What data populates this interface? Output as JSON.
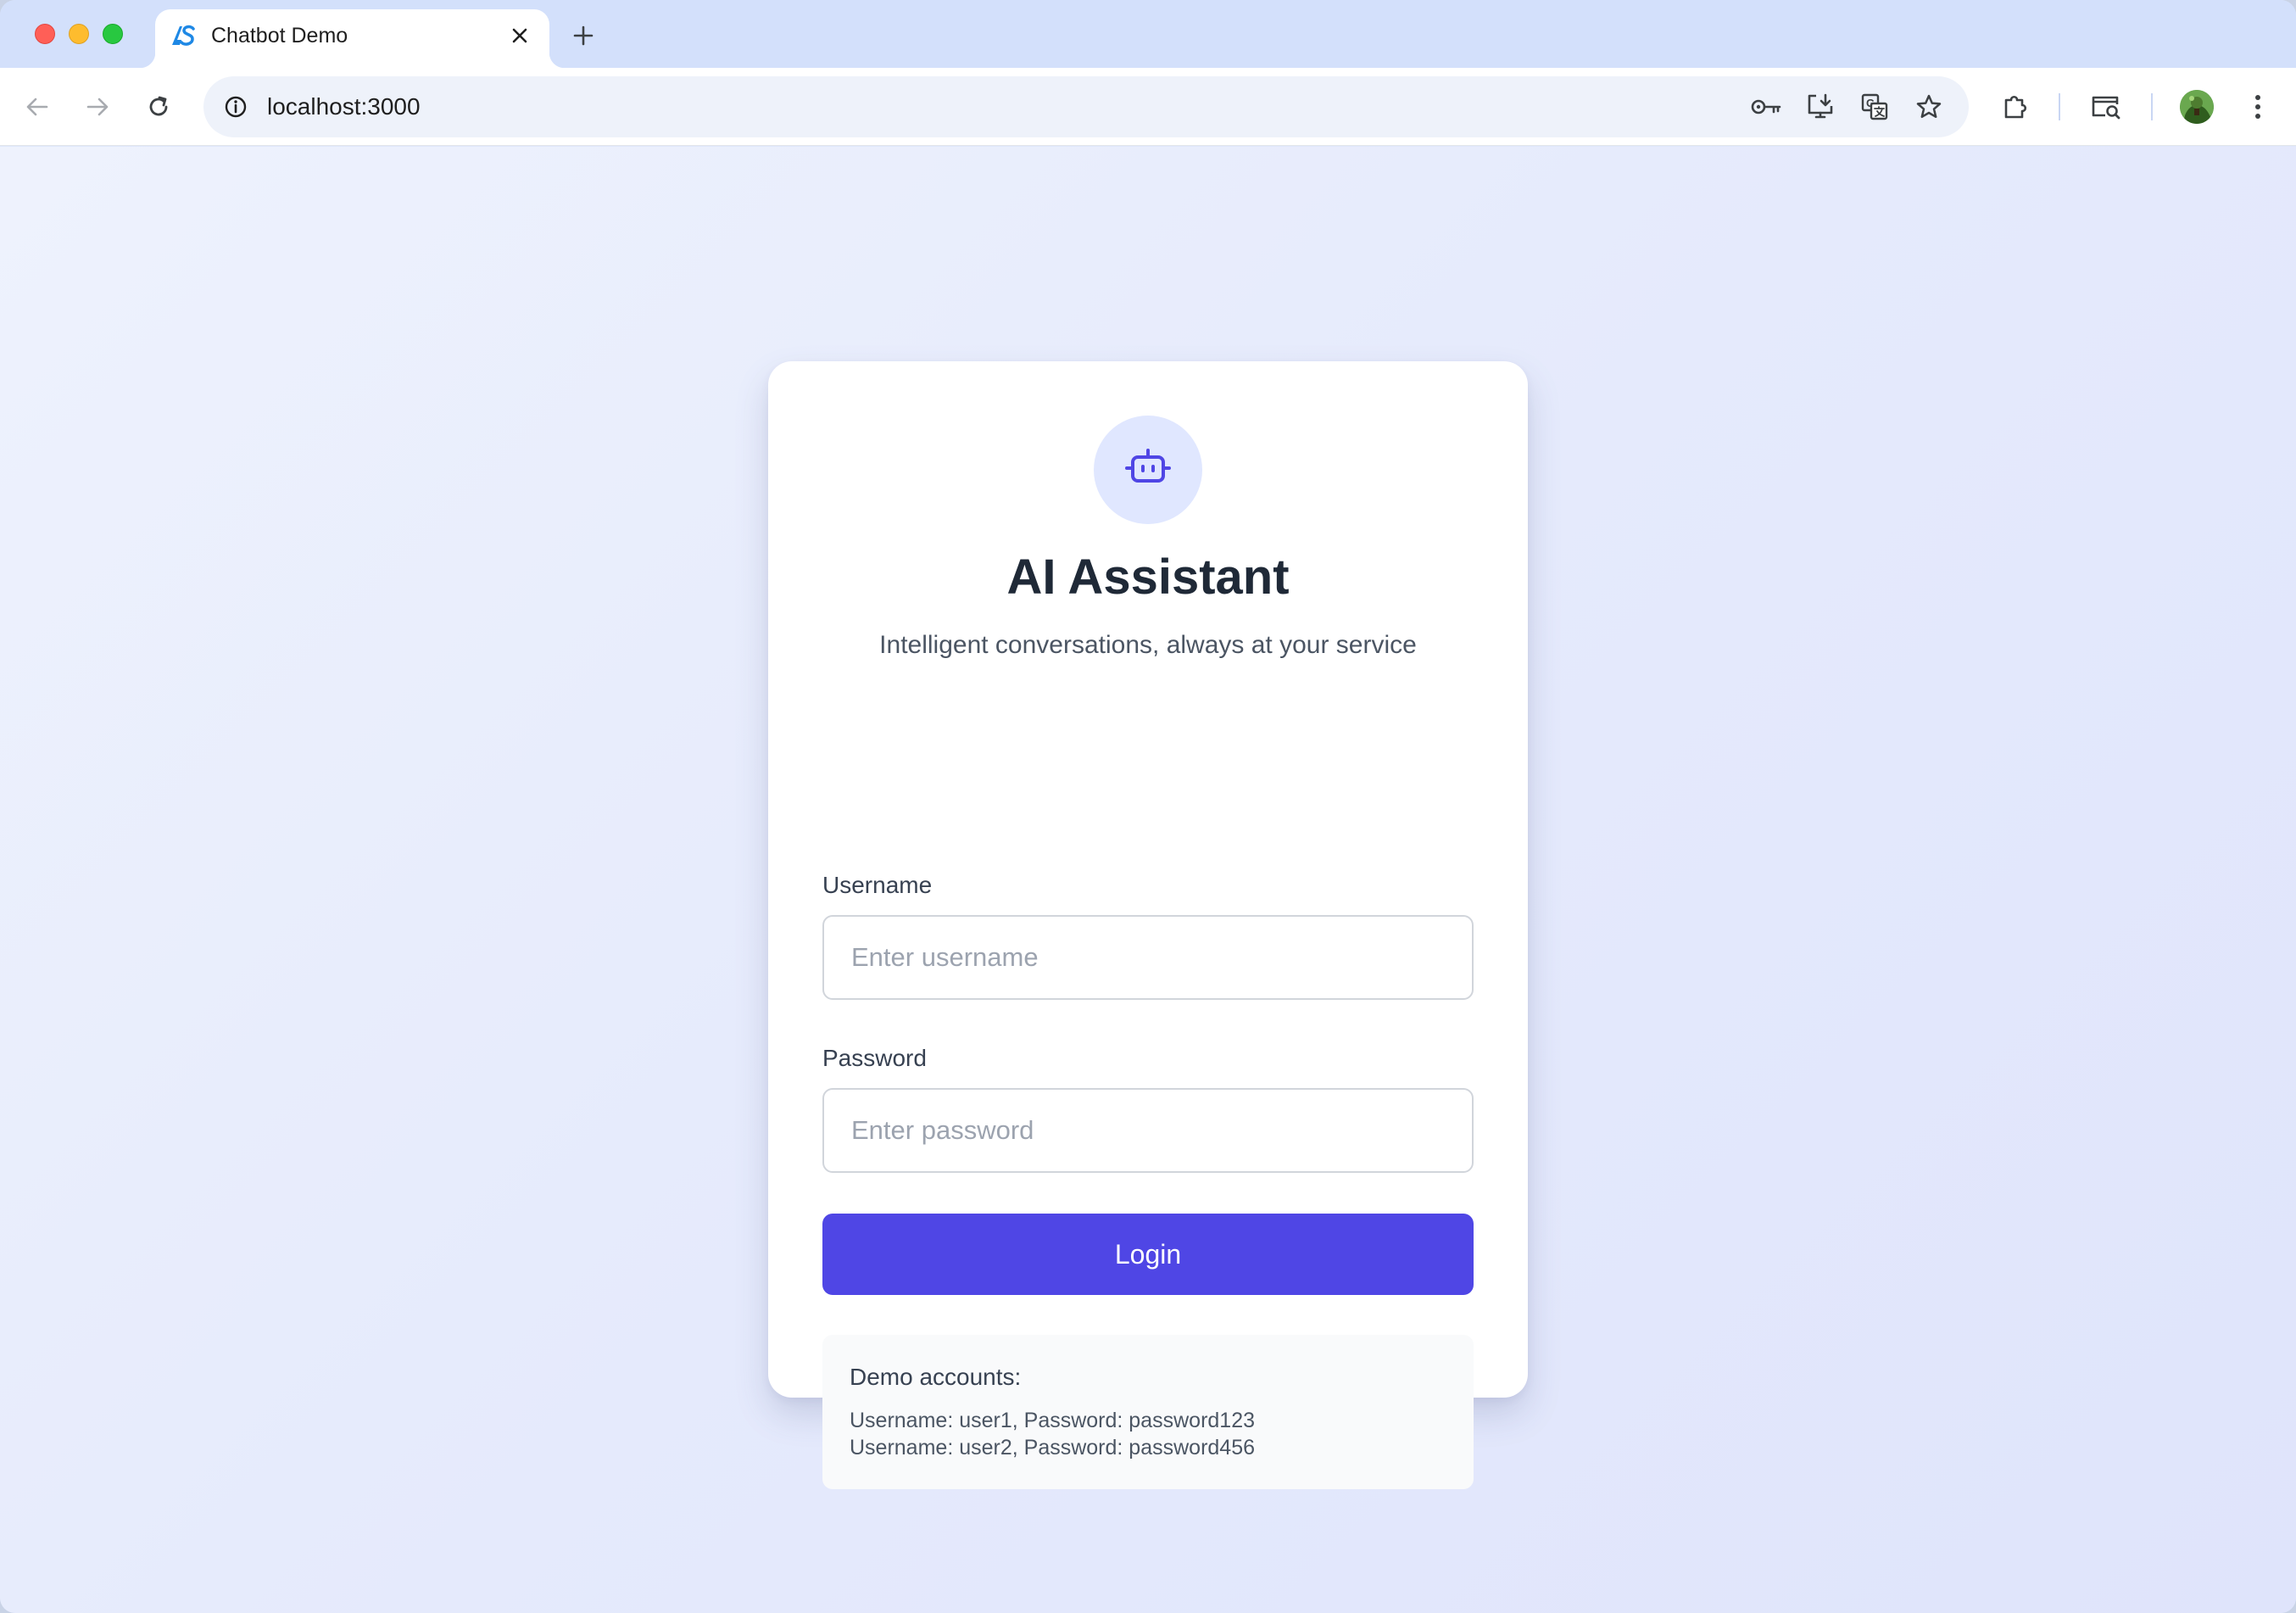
{
  "browser": {
    "tab_title": "Chatbot Demo",
    "url": "localhost:3000"
  },
  "login": {
    "title": "AI Assistant",
    "subtitle": "Intelligent conversations, always at your service",
    "username_label": "Username",
    "username_placeholder": "Enter username",
    "username_value": "",
    "password_label": "Password",
    "password_placeholder": "Enter password",
    "password_value": "",
    "submit_label": "Login"
  },
  "demo": {
    "title": "Demo accounts:",
    "accounts": [
      "Username: user1, Password: password123",
      "Username: user2, Password: password456"
    ]
  },
  "icons": {
    "card": "robot-icon",
    "toolbar": [
      "back-arrow-icon",
      "forward-arrow-icon",
      "reload-icon",
      "site-info-icon",
      "password-key-icon",
      "install-app-icon",
      "translate-icon",
      "bookmark-star-icon",
      "extensions-puzzle-icon",
      "tab-search-icon",
      "profile-avatar",
      "more-menu-icon"
    ]
  },
  "colors": {
    "accent": "#4f46e5",
    "accent_light": "#e0e7ff",
    "title_text": "#1f2937"
  }
}
